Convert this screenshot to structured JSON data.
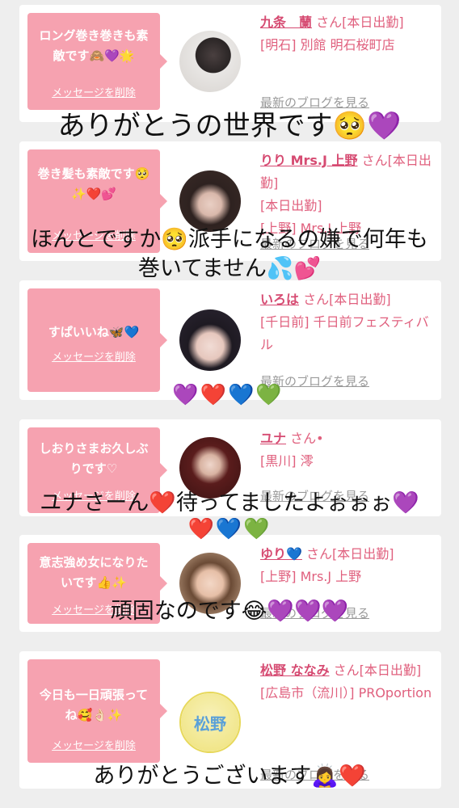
{
  "cards": [
    {
      "message": "ロング巻き巻きも素敵です🙈💜🌟",
      "delete_label": "メッセージを削除",
      "name": "九条　蘭",
      "name_suffix": "さん[本日出勤]",
      "location": "[明石] 別館 明石桜町店",
      "blog_label": "最新のブログを見る"
    },
    {
      "message": "巻き髪も素敵です🥺✨❤️💕",
      "delete_label": "メッセージを削除",
      "name": "りり Mrs.J 上野",
      "name_suffix": "さん[本日出勤]",
      "location": "[上野] Mrs.J 上野",
      "blog_label": "最新のブログを見る"
    },
    {
      "message": "すぱいいね🦋💙",
      "delete_label": "メッセージを削除",
      "name": "いろは",
      "name_suffix": "さん[本日出勤]",
      "location": "[千日前] 千日前フェスティバル",
      "blog_label": "最新のブログを見る"
    },
    {
      "message": "しおりさまお久しぶりです♡",
      "delete_label": "メッセージを削除",
      "name": "ユナ",
      "name_suffix": "さん•",
      "location": "[黒川] 澪",
      "blog_label": "最新のブログを見る"
    },
    {
      "message": "意志強め女になりたいです👍✨",
      "delete_label": "メッセージを削除",
      "name": "ゆり💙",
      "name_suffix": "さん[本日出勤]",
      "location": "[上野] Mrs.J 上野",
      "blog_label": "最新のブログを見る"
    },
    {
      "message": "今日も一日頑張ってね🥰👌🏻✨",
      "delete_label": "メッセージを削除",
      "name": "松野 ななみ",
      "name_suffix": "さん[本日出勤]",
      "location": "[広島市（流川）] PROportion",
      "blog_label": "最新のブログを見る",
      "avatar_text": "松野"
    }
  ],
  "overlays": {
    "o1": "ありがとうの世界です🥺💜",
    "o2_line1": "ほんとですか🥺派手になるの嫌で何年も",
    "o2_line2": "巻いてません💦💕",
    "o3": "💜❤️💙💚",
    "o4_line1": "ユナさーん❤️待ってましたよぉぉぉ💜",
    "o4_line2": "❤️💙💚",
    "o5": "頑固なのです😂💜💜💜",
    "o6": "ありがとうございます🙇‍♀️❤️"
  },
  "colors": {
    "bubble": "#f6a2b0",
    "name": "#d64b72",
    "info": "#e0607e",
    "blog": "#9a9a9a",
    "background": "#eeeeee"
  }
}
